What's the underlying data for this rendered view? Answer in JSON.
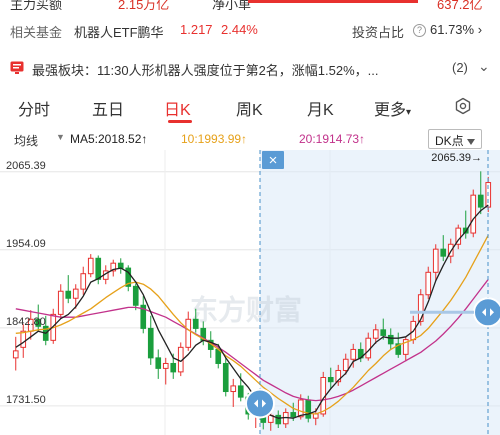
{
  "top_strip": {
    "left_text": "主力买额",
    "mid_value": "2.15万亿",
    "mid_label": "净小单",
    "right_value": "637.2亿"
  },
  "related": {
    "label": "相关基金",
    "fund_name": "机器人ETF鹏华",
    "price": "1.217",
    "change_pct": "2.44%",
    "invest_label": "投资占比",
    "help_icon": "?",
    "invest_ratio": "61.73%",
    "chevron": "›"
  },
  "sector": {
    "icon": "news-icon",
    "text": "最强板块：11:30人形机器人强度位于第2名，涨幅1.52%，...",
    "count": "(2)",
    "chevron": "⌄"
  },
  "tabs": [
    {
      "label": "分时"
    },
    {
      "label": "五日"
    },
    {
      "label": "日K"
    },
    {
      "label": "周K"
    },
    {
      "label": "月K"
    },
    {
      "label": "更多"
    }
  ],
  "more_arrow": "▾",
  "active_tab": "日K",
  "legend": {
    "indicator": "均线",
    "indicator_arrow": "▼",
    "ma5": "MA5:2018.52↑",
    "ma10": "10:1993.99↑",
    "ma20": "20:1914.73↑",
    "dk_button": "DK点"
  },
  "colors": {
    "up": "#e8312f",
    "down": "#1a9e3d",
    "ma5": "#222222",
    "ma10": "#e6a11a",
    "ma20": "#c2328b",
    "accent": "#e8312f",
    "selection": "#4a90c8"
  },
  "chart_data": {
    "type": "candlestick",
    "y_ticks": [
      "2065.39",
      "1954.09",
      "1842.80",
      "1731.50"
    ],
    "y_tick_values": [
      2065.39,
      1954.09,
      1842.8,
      1731.5
    ],
    "ylim": [
      1690,
      2085
    ],
    "max_marker": "2065.39→",
    "close_icon": "×",
    "watermark": "东方财富",
    "candles": [
      {
        "o": 1800,
        "h": 1830,
        "l": 1782,
        "c": 1810
      },
      {
        "o": 1815,
        "h": 1848,
        "l": 1800,
        "c": 1838
      },
      {
        "o": 1838,
        "h": 1868,
        "l": 1826,
        "c": 1855
      },
      {
        "o": 1855,
        "h": 1876,
        "l": 1838,
        "c": 1845
      },
      {
        "o": 1845,
        "h": 1860,
        "l": 1818,
        "c": 1825
      },
      {
        "o": 1825,
        "h": 1870,
        "l": 1820,
        "c": 1862
      },
      {
        "o": 1862,
        "h": 1905,
        "l": 1856,
        "c": 1895
      },
      {
        "o": 1895,
        "h": 1918,
        "l": 1878,
        "c": 1885
      },
      {
        "o": 1885,
        "h": 1905,
        "l": 1870,
        "c": 1898
      },
      {
        "o": 1898,
        "h": 1930,
        "l": 1890,
        "c": 1920
      },
      {
        "o": 1920,
        "h": 1948,
        "l": 1915,
        "c": 1942
      },
      {
        "o": 1942,
        "h": 1946,
        "l": 1905,
        "c": 1912
      },
      {
        "o": 1912,
        "h": 1932,
        "l": 1905,
        "c": 1924
      },
      {
        "o": 1924,
        "h": 1940,
        "l": 1916,
        "c": 1935
      },
      {
        "o": 1935,
        "h": 1942,
        "l": 1920,
        "c": 1928
      },
      {
        "o": 1928,
        "h": 1932,
        "l": 1895,
        "c": 1902
      },
      {
        "o": 1902,
        "h": 1906,
        "l": 1868,
        "c": 1875
      },
      {
        "o": 1875,
        "h": 1888,
        "l": 1835,
        "c": 1842
      },
      {
        "o": 1842,
        "h": 1860,
        "l": 1790,
        "c": 1800
      },
      {
        "o": 1800,
        "h": 1812,
        "l": 1770,
        "c": 1785
      },
      {
        "o": 1785,
        "h": 1800,
        "l": 1762,
        "c": 1792
      },
      {
        "o": 1792,
        "h": 1806,
        "l": 1770,
        "c": 1780
      },
      {
        "o": 1780,
        "h": 1822,
        "l": 1774,
        "c": 1815
      },
      {
        "o": 1815,
        "h": 1866,
        "l": 1810,
        "c": 1855
      },
      {
        "o": 1855,
        "h": 1870,
        "l": 1836,
        "c": 1842
      },
      {
        "o": 1842,
        "h": 1852,
        "l": 1818,
        "c": 1825
      },
      {
        "o": 1825,
        "h": 1838,
        "l": 1800,
        "c": 1812
      },
      {
        "o": 1812,
        "h": 1820,
        "l": 1785,
        "c": 1792
      },
      {
        "o": 1792,
        "h": 1800,
        "l": 1745,
        "c": 1752
      },
      {
        "o": 1752,
        "h": 1770,
        "l": 1730,
        "c": 1760
      },
      {
        "o": 1760,
        "h": 1778,
        "l": 1738,
        "c": 1744
      },
      {
        "o": 1744,
        "h": 1750,
        "l": 1712,
        "c": 1720
      },
      {
        "o": 1720,
        "h": 1735,
        "l": 1700,
        "c": 1728
      },
      {
        "o": 1728,
        "h": 1734,
        "l": 1698,
        "c": 1708
      },
      {
        "o": 1708,
        "h": 1726,
        "l": 1696,
        "c": 1718
      },
      {
        "o": 1718,
        "h": 1725,
        "l": 1700,
        "c": 1706
      },
      {
        "o": 1706,
        "h": 1728,
        "l": 1700,
        "c": 1722
      },
      {
        "o": 1722,
        "h": 1736,
        "l": 1710,
        "c": 1716
      },
      {
        "o": 1716,
        "h": 1748,
        "l": 1712,
        "c": 1740
      },
      {
        "o": 1740,
        "h": 1746,
        "l": 1708,
        "c": 1714
      },
      {
        "o": 1714,
        "h": 1728,
        "l": 1704,
        "c": 1720
      },
      {
        "o": 1720,
        "h": 1780,
        "l": 1716,
        "c": 1772
      },
      {
        "o": 1772,
        "h": 1786,
        "l": 1756,
        "c": 1766
      },
      {
        "o": 1766,
        "h": 1790,
        "l": 1760,
        "c": 1782
      },
      {
        "o": 1782,
        "h": 1806,
        "l": 1776,
        "c": 1798
      },
      {
        "o": 1798,
        "h": 1820,
        "l": 1786,
        "c": 1812
      },
      {
        "o": 1812,
        "h": 1822,
        "l": 1794,
        "c": 1800
      },
      {
        "o": 1800,
        "h": 1836,
        "l": 1796,
        "c": 1828
      },
      {
        "o": 1828,
        "h": 1848,
        "l": 1820,
        "c": 1840
      },
      {
        "o": 1840,
        "h": 1856,
        "l": 1826,
        "c": 1832
      },
      {
        "o": 1832,
        "h": 1842,
        "l": 1812,
        "c": 1820
      },
      {
        "o": 1820,
        "h": 1836,
        "l": 1800,
        "c": 1805
      },
      {
        "o": 1805,
        "h": 1830,
        "l": 1795,
        "c": 1826
      },
      {
        "o": 1826,
        "h": 1860,
        "l": 1820,
        "c": 1852
      },
      {
        "o": 1852,
        "h": 1898,
        "l": 1846,
        "c": 1890
      },
      {
        "o": 1890,
        "h": 1930,
        "l": 1884,
        "c": 1922
      },
      {
        "o": 1922,
        "h": 1962,
        "l": 1910,
        "c": 1955
      },
      {
        "o": 1955,
        "h": 1975,
        "l": 1938,
        "c": 1945
      },
      {
        "o": 1945,
        "h": 1970,
        "l": 1935,
        "c": 1962
      },
      {
        "o": 1962,
        "h": 1990,
        "l": 1955,
        "c": 1985
      },
      {
        "o": 1985,
        "h": 2010,
        "l": 1970,
        "c": 1978
      },
      {
        "o": 1978,
        "h": 2040,
        "l": 1972,
        "c": 2032
      },
      {
        "o": 2032,
        "h": 2066,
        "l": 2005,
        "c": 2015
      },
      {
        "o": 2015,
        "h": 2058,
        "l": 2008,
        "c": 2050
      }
    ],
    "ma5": [
      1815,
      1822,
      1830,
      1838,
      1835,
      1845,
      1856,
      1862,
      1873,
      1888,
      1908,
      1913,
      1920,
      1926,
      1928,
      1922,
      1908,
      1890,
      1865,
      1840,
      1820,
      1800,
      1795,
      1805,
      1818,
      1825,
      1822,
      1818,
      1800,
      1785,
      1770,
      1758,
      1742,
      1728,
      1718,
      1714,
      1715,
      1714,
      1718,
      1720,
      1724,
      1742,
      1756,
      1768,
      1778,
      1795,
      1800,
      1810,
      1822,
      1830,
      1828,
      1828,
      1830,
      1838,
      1855,
      1880,
      1910,
      1932,
      1952,
      1968,
      1980,
      1998,
      2010,
      2018
    ],
    "ma10": [
      1835,
      1836,
      1838,
      1840,
      1841,
      1843,
      1847,
      1852,
      1858,
      1864,
      1870,
      1878,
      1886,
      1893,
      1900,
      1906,
      1908,
      1905,
      1898,
      1888,
      1875,
      1862,
      1850,
      1840,
      1833,
      1827,
      1820,
      1812,
      1803,
      1796,
      1788,
      1778,
      1768,
      1758,
      1750,
      1742,
      1735,
      1728,
      1724,
      1721,
      1720,
      1724,
      1730,
      1738,
      1748,
      1758,
      1770,
      1782,
      1792,
      1803,
      1812,
      1818,
      1822,
      1826,
      1832,
      1842,
      1855,
      1868,
      1882,
      1898,
      1915,
      1935,
      1955,
      1975
    ],
    "ma20": [
      1870,
      1868,
      1866,
      1864,
      1862,
      1860,
      1858,
      1858,
      1858,
      1860,
      1862,
      1864,
      1866,
      1868,
      1870,
      1872,
      1872,
      1870,
      1866,
      1862,
      1858,
      1852,
      1846,
      1840,
      1834,
      1828,
      1822,
      1815,
      1808,
      1800,
      1792,
      1784,
      1776,
      1768,
      1762,
      1756,
      1750,
      1745,
      1742,
      1740,
      1739,
      1740,
      1742,
      1745,
      1749,
      1754,
      1760,
      1766,
      1772,
      1778,
      1784,
      1790,
      1796,
      1802,
      1808,
      1816,
      1824,
      1834,
      1845,
      1857,
      1870,
      1884,
      1898,
      1912
    ]
  }
}
